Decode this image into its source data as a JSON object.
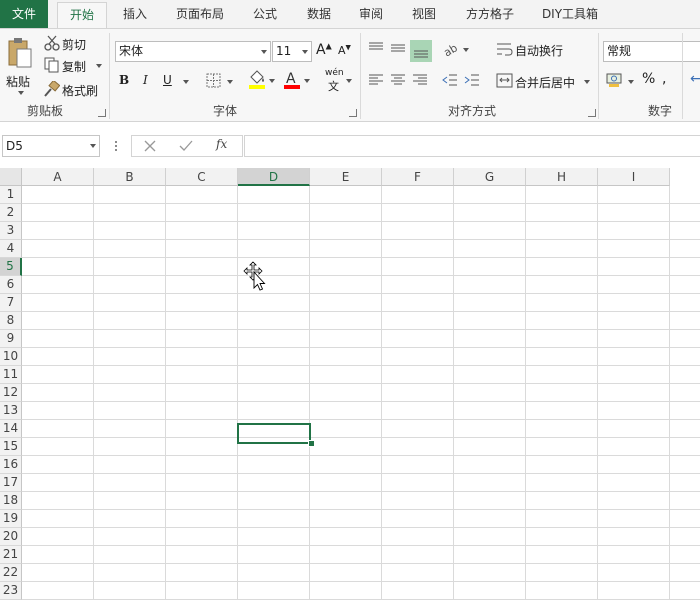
{
  "tabs": {
    "file": "文件",
    "home": "开始",
    "insert": "插入",
    "layout": "页面布局",
    "formulas": "公式",
    "data": "数据",
    "review": "审阅",
    "view": "视图",
    "ffgz": "方方格子",
    "diy": "DIY工具箱"
  },
  "clipboard": {
    "paste": "粘贴",
    "cut": "剪切",
    "copy": "复制",
    "format_painter": "格式刷",
    "group": "剪贴板"
  },
  "font": {
    "name": "宋体",
    "size": "11",
    "bold": "B",
    "italic": "I",
    "underline": "U",
    "phonetic": "wén",
    "group": "字体",
    "highlight_color": "#ffff00",
    "text_color": "#ff0000"
  },
  "alignment": {
    "wrap_text": "自动换行",
    "merge_center": "合并后居中",
    "group": "对齐方式"
  },
  "number": {
    "format": "常规",
    "percent": "%",
    "group": "数字"
  },
  "formula_bar": {
    "name_box": "D5",
    "fx": "fx",
    "content": ""
  },
  "sheet": {
    "columns": [
      "A",
      "B",
      "C",
      "D",
      "E",
      "F",
      "G",
      "H",
      "I"
    ],
    "rows": [
      "1",
      "2",
      "3",
      "4",
      "5",
      "6",
      "7",
      "8",
      "9",
      "10",
      "11",
      "12",
      "13",
      "14",
      "15",
      "16",
      "17",
      "18",
      "19",
      "20",
      "21",
      "22",
      "23"
    ],
    "selected_cell": "D5",
    "accent": "#217346"
  }
}
